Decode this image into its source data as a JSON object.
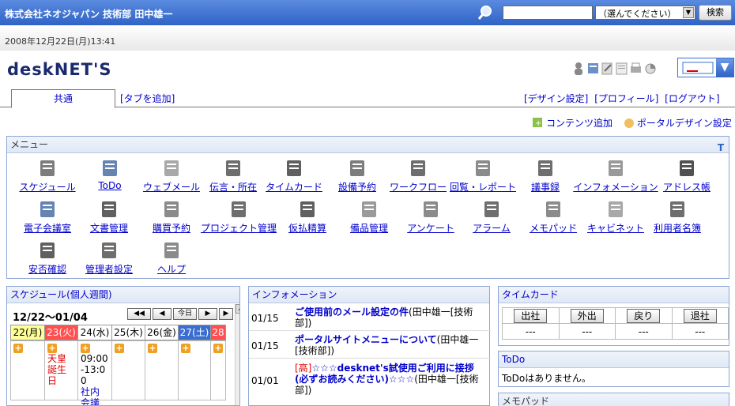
{
  "header": {
    "company_user": "株式会社ネオジャパン 技術部 田中雄一",
    "search_placeholder": "",
    "select_value": "（選んでください）",
    "search_button": "検索"
  },
  "datebar": {
    "datetime": "2008年12月22日(月)13:41"
  },
  "logo": {
    "text": "deskNET'S"
  },
  "tabs": {
    "active": "共通",
    "add_tab": "[タブを追加]",
    "design": "[デザイン設定]",
    "profile": "[プロフィール]",
    "logout": "[ログアウト]"
  },
  "subactions": {
    "add_content": "コンテンツ追加",
    "portal_design": "ポータルデザイン設定"
  },
  "menu": {
    "title": "メニュー",
    "toggle": "T",
    "items": [
      "スケジュール",
      "ToDo",
      "ウェブメール",
      "伝言・所在",
      "タイムカード",
      "設備予約",
      "ワークフロー",
      "回覧・レポート",
      "議事録",
      "インフォメーション",
      "アドレス帳",
      "電子会議室",
      "文書管理",
      "購買予約",
      "プロジェクト管理",
      "仮払精算",
      "備品管理",
      "アンケート",
      "アラーム",
      "メモパッド",
      "キャビネット",
      "利用者名簿",
      "安否確認",
      "管理者設定",
      "ヘルプ"
    ]
  },
  "schedule": {
    "title": "スケジュール(個人週間)",
    "range": "12/22～01/04",
    "today_button": "今日",
    "days": [
      "22(月)",
      "23(火)",
      "24(水)",
      "25(木)",
      "26(金)",
      "27(土)",
      "28"
    ],
    "holiday_label": "天皇誕生日",
    "event_time": "09:00-13:00",
    "event_title": "社内会議"
  },
  "information": {
    "title": "インフォメーション",
    "rows": [
      {
        "date": "01/15",
        "link": "ご使用前のメール設定の件",
        "author": "(田中雄一[技術部])"
      },
      {
        "date": "01/15",
        "link": "ポータルサイトメニューについて",
        "author": "(田中雄一[技術部])"
      },
      {
        "date": "01/01",
        "priority": "[高]",
        "link": "☆☆☆desknet's試使用ご利用に接拶(必ずお読みください)☆☆☆",
        "author": "(田中雄一[技術部])"
      }
    ]
  },
  "timecard": {
    "title": "タイムカード",
    "buttons": [
      "出社",
      "外出",
      "戻り",
      "退社"
    ],
    "values": [
      "---",
      "---",
      "---",
      "---"
    ]
  },
  "todo": {
    "title": "ToDo",
    "message": "ToDoはありません。"
  },
  "memo": {
    "title": "メモパッド"
  }
}
